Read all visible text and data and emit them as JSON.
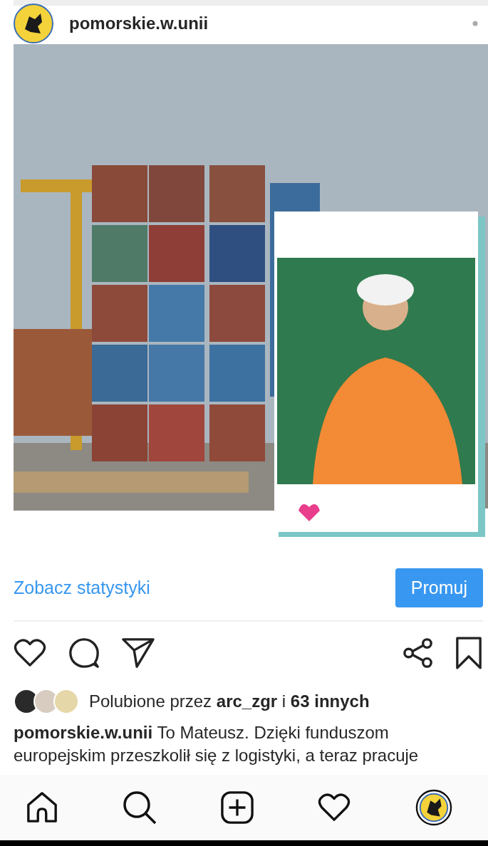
{
  "header": {
    "username": "pomorskie.w.unii"
  },
  "insights_link": "Zobacz statystyki",
  "promote_button": "Promuj",
  "actions": {
    "liked": false,
    "saved": false
  },
  "likes": {
    "text": "Polubione przez **arc_zgr** i **63 innych**"
  },
  "caption": {
    "username": "pomorskie.w.unii",
    "text": "To Mateusz. Dzięki funduszom europejskim przeszkolił się z logistyki, a teraz pracuje"
  },
  "nav": [
    {
      "kind": "home"
    },
    {
      "kind": "search"
    },
    {
      "kind": "add"
    },
    {
      "kind": "activity"
    },
    {
      "kind": "profile"
    }
  ]
}
